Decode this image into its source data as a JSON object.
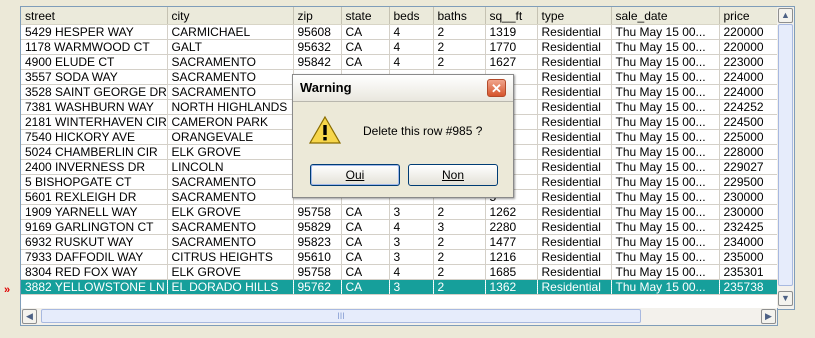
{
  "table": {
    "columns": [
      "street",
      "city",
      "zip",
      "state",
      "beds",
      "baths",
      "sq__ft",
      "type",
      "sale_date",
      "price"
    ],
    "rows": [
      [
        "5429 HESPER WAY",
        "CARMICHAEL",
        "95608",
        "CA",
        "4",
        "2",
        "1319",
        "Residential",
        "Thu May 15 00...",
        "220000"
      ],
      [
        "1178 WARMWOOD CT",
        "GALT",
        "95632",
        "CA",
        "4",
        "2",
        "1770",
        "Residential",
        "Thu May 15 00...",
        "220000"
      ],
      [
        "4900 ELUDE CT",
        "SACRAMENTO",
        "95842",
        "CA",
        "4",
        "2",
        "1627",
        "Residential",
        "Thu May 15 00...",
        "223000"
      ],
      [
        "3557 SODA WAY",
        "SACRAMENTO",
        "",
        "",
        "",
        "",
        "",
        "Residential",
        "Thu May 15 00...",
        "224000"
      ],
      [
        "3528 SAINT GEORGE DR",
        "SACRAMENTO",
        "",
        "",
        "",
        "",
        "0",
        "Residential",
        "Thu May 15 00...",
        "224000"
      ],
      [
        "7381 WASHBURN WAY",
        "NORTH HIGHLANDS",
        "",
        "",
        "",
        "",
        "",
        "Residential",
        "Thu May 15 00...",
        "224252"
      ],
      [
        "2181 WINTERHAVEN CIR",
        "CAMERON PARK",
        "",
        "",
        "",
        "",
        "",
        "Residential",
        "Thu May 15 00...",
        "224500"
      ],
      [
        "7540 HICKORY AVE",
        "ORANGEVALE",
        "",
        "",
        "",
        "",
        "6",
        "Residential",
        "Thu May 15 00...",
        "225000"
      ],
      [
        "5024 CHAMBERLIN CIR",
        "ELK GROVE",
        "",
        "",
        "",
        "",
        "0",
        "Residential",
        "Thu May 15 00...",
        "228000"
      ],
      [
        "2400 INVERNESS DR",
        "LINCOLN",
        "",
        "",
        "",
        "",
        "8",
        "Residential",
        "Thu May 15 00...",
        "229027"
      ],
      [
        "5 BISHOPGATE CT",
        "SACRAMENTO",
        "",
        "",
        "",
        "",
        "9",
        "Residential",
        "Thu May 15 00...",
        "229500"
      ],
      [
        "5601 REXLEIGH DR",
        "SACRAMENTO",
        "",
        "",
        "",
        "",
        "5",
        "Residential",
        "Thu May 15 00...",
        "230000"
      ],
      [
        "1909 YARNELL WAY",
        "ELK GROVE",
        "95758",
        "CA",
        "3",
        "2",
        "1262",
        "Residential",
        "Thu May 15 00...",
        "230000"
      ],
      [
        "9169 GARLINGTON CT",
        "SACRAMENTO",
        "95829",
        "CA",
        "4",
        "3",
        "2280",
        "Residential",
        "Thu May 15 00...",
        "232425"
      ],
      [
        "6932 RUSKUT WAY",
        "SACRAMENTO",
        "95823",
        "CA",
        "3",
        "2",
        "1477",
        "Residential",
        "Thu May 15 00...",
        "234000"
      ],
      [
        "7933 DAFFODIL WAY",
        "CITRUS HEIGHTS",
        "95610",
        "CA",
        "3",
        "2",
        "1216",
        "Residential",
        "Thu May 15 00...",
        "235000"
      ],
      [
        "8304 RED FOX WAY",
        "ELK GROVE",
        "95758",
        "CA",
        "4",
        "2",
        "1685",
        "Residential",
        "Thu May 15 00...",
        "235301"
      ],
      [
        "3882 YELLOWSTONE LN",
        "EL DORADO HILLS",
        "95762",
        "CA",
        "3",
        "2",
        "1362",
        "Residential",
        "Thu May 15 00...",
        "235738"
      ]
    ],
    "selected_row_index": 17,
    "row_indicator": "»"
  },
  "scrollbars": {
    "up_arrow": "▲",
    "down_arrow": "▼",
    "left_arrow": "◀",
    "right_arrow": "▶",
    "grip": "III"
  },
  "dialog": {
    "title": "Warning",
    "close_glyph": "✕",
    "message": "Delete this row #985 ?",
    "yes_label": "Oui",
    "no_label": "Non",
    "icon": "warning-icon"
  }
}
